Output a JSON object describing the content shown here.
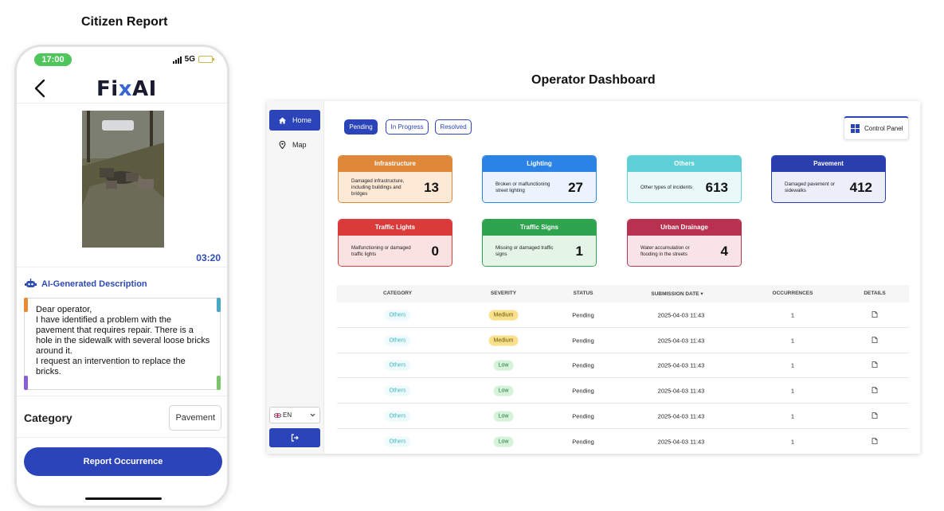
{
  "captions": {
    "citizen": "Citizen Report",
    "operator": "Operator Dashboard"
  },
  "phone": {
    "status_time": "17:00",
    "network": "5G",
    "logo_parts": [
      "Fi",
      "x",
      "AI"
    ],
    "photo_timestamp": "03:20",
    "ai_title": "AI-Generated Description",
    "description": "Dear operator,\nI have identified a problem with the pavement that requires repair. There is a hole in the sidewalk with several loose bricks around it.\nI request an intervention to replace the bricks.",
    "category_label": "Category",
    "category_value": "Pavement",
    "report_button": "Report Occurrence",
    "accent_color": "#2b44b9"
  },
  "dashboard": {
    "nav": {
      "home": "Home",
      "map": "Map"
    },
    "language": "EN",
    "tabs": [
      "Pending",
      "In Progress",
      "Resolved"
    ],
    "control_panel": "Control Panel",
    "cards": [
      {
        "title": "Infrastructure",
        "desc": "Damaged infrastructure, including buildings and bridges",
        "count": "13",
        "head": "#e0883a",
        "body": "#fde9d6"
      },
      {
        "title": "Lighting",
        "desc": "Broken or malfunctioning street lighting",
        "count": "27",
        "head": "#2c83e6",
        "body": "#eaf3fe"
      },
      {
        "title": "Others",
        "desc": "Other types of incidents",
        "count": "613",
        "head": "#5fd0d8",
        "body": "#e9f9fa"
      },
      {
        "title": "Pavement",
        "desc": "Damaged pavement or sidewalks",
        "count": "412",
        "head": "#2a3fae",
        "body": "#eceefa"
      },
      {
        "title": "Traffic Lights",
        "desc": "Malfunctioning or damaged traffic lights",
        "count": "0",
        "head": "#d93a3a",
        "body": "#fbe2e2"
      },
      {
        "title": "Traffic Signs",
        "desc": "Missing or damaged traffic signs",
        "count": "1",
        "head": "#2ea44f",
        "body": "#e4f5e8"
      },
      {
        "title": "Urban Drainage",
        "desc": "Water accumulation or flooding in the streets",
        "count": "4",
        "head": "#b8324f",
        "body": "#f8e3e8"
      }
    ],
    "table": {
      "headers": [
        "Category",
        "Severity",
        "Status",
        "Submission Date",
        "Occurrences",
        "Details"
      ],
      "sort_indicator": "▾",
      "rows": [
        {
          "category": "Others",
          "severity": "Medium",
          "status": "Pending",
          "date": "2025-04-03 11:43",
          "occurrences": "1"
        },
        {
          "category": "Others",
          "severity": "Medium",
          "status": "Pending",
          "date": "2025-04-03 11:43",
          "occurrences": "1"
        },
        {
          "category": "Others",
          "severity": "Low",
          "status": "Pending",
          "date": "2025-04-03 11:43",
          "occurrences": "1"
        },
        {
          "category": "Others",
          "severity": "Low",
          "status": "Pending",
          "date": "2025-04-03 11:43",
          "occurrences": "1"
        },
        {
          "category": "Others",
          "severity": "Low",
          "status": "Pending",
          "date": "2025-04-03 11:43",
          "occurrences": "1"
        },
        {
          "category": "Others",
          "severity": "Low",
          "status": "Pending",
          "date": "2025-04-03 11:43",
          "occurrences": "1"
        }
      ]
    }
  }
}
